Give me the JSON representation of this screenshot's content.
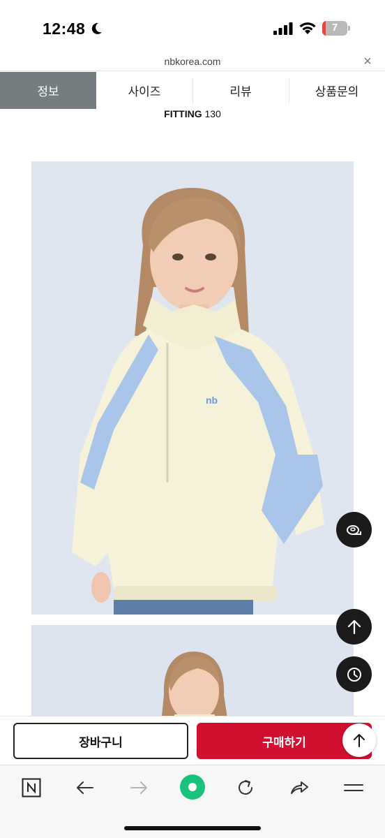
{
  "status": {
    "time": "12:48",
    "battery_level": "7",
    "icons": [
      "moon-icon",
      "signal-icon",
      "wifi-icon",
      "battery-icon"
    ]
  },
  "browser": {
    "url": "nbkorea.com",
    "close_symbol": "×"
  },
  "tabs": [
    {
      "label": "정보",
      "active": true
    },
    {
      "label": "사이즈",
      "active": false
    },
    {
      "label": "리뷰",
      "active": false
    },
    {
      "label": "상품문의",
      "active": false
    }
  ],
  "fitting": {
    "label": "FITTING",
    "value": "130"
  },
  "floating_buttons": [
    "measure-tape-icon",
    "arrow-up-icon",
    "clock-icon"
  ],
  "purchase": {
    "cart_label": "장바구니",
    "buy_label": "구매하기"
  },
  "toolbar": [
    "naver-n-icon",
    "back-arrow-icon",
    "forward-arrow-icon",
    "green-dot-home-icon",
    "refresh-icon",
    "share-icon",
    "menu-icon"
  ],
  "colors": {
    "active_tab": "#767d80",
    "buy_button": "#d1102f",
    "home_green": "#19c37d",
    "photo_bg": "#dfe5ef"
  }
}
